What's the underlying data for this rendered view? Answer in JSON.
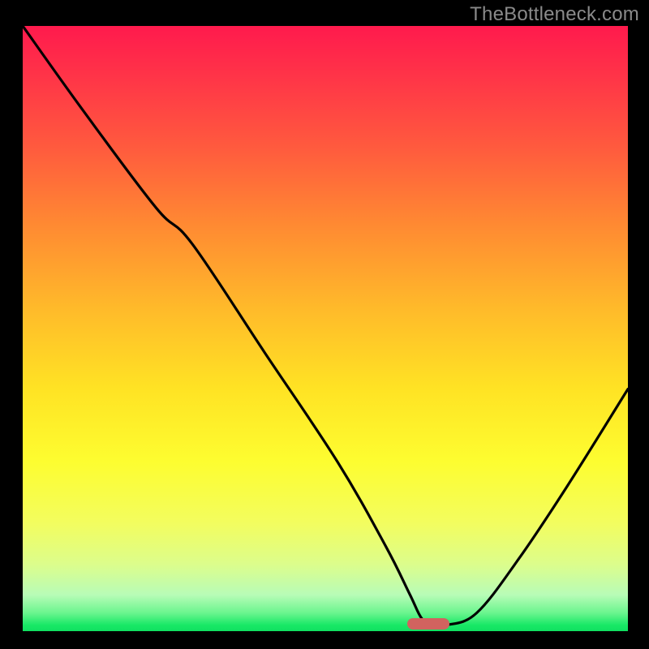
{
  "watermark": "TheBottleneck.com",
  "colors": {
    "frame_bg": "#000000",
    "curve": "#000000",
    "marker": "#d1635f"
  },
  "chart_data": {
    "type": "line",
    "title": "",
    "xlabel": "",
    "ylabel": "",
    "xlim": [
      0,
      100
    ],
    "ylim": [
      0,
      100
    ],
    "grid": false,
    "legend": false,
    "series": [
      {
        "name": "curve",
        "x": [
          0,
          10,
          22,
          28,
          40,
          52,
          60,
          64,
          66,
          68,
          70,
          75,
          82,
          90,
          100
        ],
        "y": [
          100,
          86,
          70,
          64,
          46,
          28,
          14,
          6,
          2,
          1,
          1,
          3,
          12,
          24,
          40
        ]
      }
    ],
    "marker": {
      "x_center": 67,
      "y": 1.2,
      "width_pct": 7
    }
  }
}
